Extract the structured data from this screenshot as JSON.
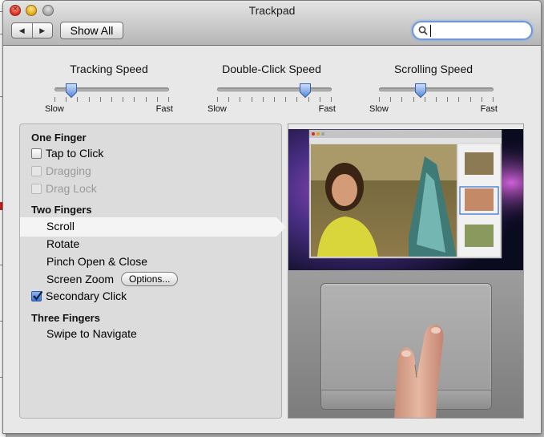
{
  "window": {
    "title": "Trackpad"
  },
  "toolbar": {
    "back_icon": "back-arrow-icon",
    "forward_icon": "forward-arrow-icon",
    "show_all_label": "Show All",
    "search": {
      "value": "",
      "placeholder": ""
    }
  },
  "sliders": [
    {
      "label": "Tracking Speed",
      "min_label": "Slow",
      "max_label": "Fast",
      "level": 0.1
    },
    {
      "label": "Double-Click Speed",
      "min_label": "Slow",
      "max_label": "Fast",
      "level": 0.8
    },
    {
      "label": "Scrolling Speed",
      "min_label": "Slow",
      "max_label": "Fast",
      "level": 0.35
    }
  ],
  "gestures": {
    "one_finger": {
      "heading": "One Finger",
      "tap_to_click": {
        "label": "Tap to Click",
        "checked": false
      },
      "dragging": {
        "label": "Dragging",
        "checked": false,
        "enabled": false
      },
      "drag_lock": {
        "label": "Drag Lock",
        "checked": false,
        "enabled": false
      }
    },
    "two_fingers": {
      "heading": "Two Fingers",
      "scroll": "Scroll",
      "rotate": "Rotate",
      "pinch": "Pinch Open & Close",
      "screen_zoom": "Screen Zoom",
      "options_label": "Options...",
      "secondary_click": {
        "label": "Secondary Click",
        "checked": true
      }
    },
    "three_fingers": {
      "heading": "Three Fingers",
      "swipe": "Swipe to Navigate"
    },
    "selected": "Scroll"
  },
  "colors": {
    "window_bg": "#e8e8e8",
    "selection": "#f4f4f4",
    "search_focus": "#6f97d8",
    "checkbox_on": "#3d74cf"
  }
}
